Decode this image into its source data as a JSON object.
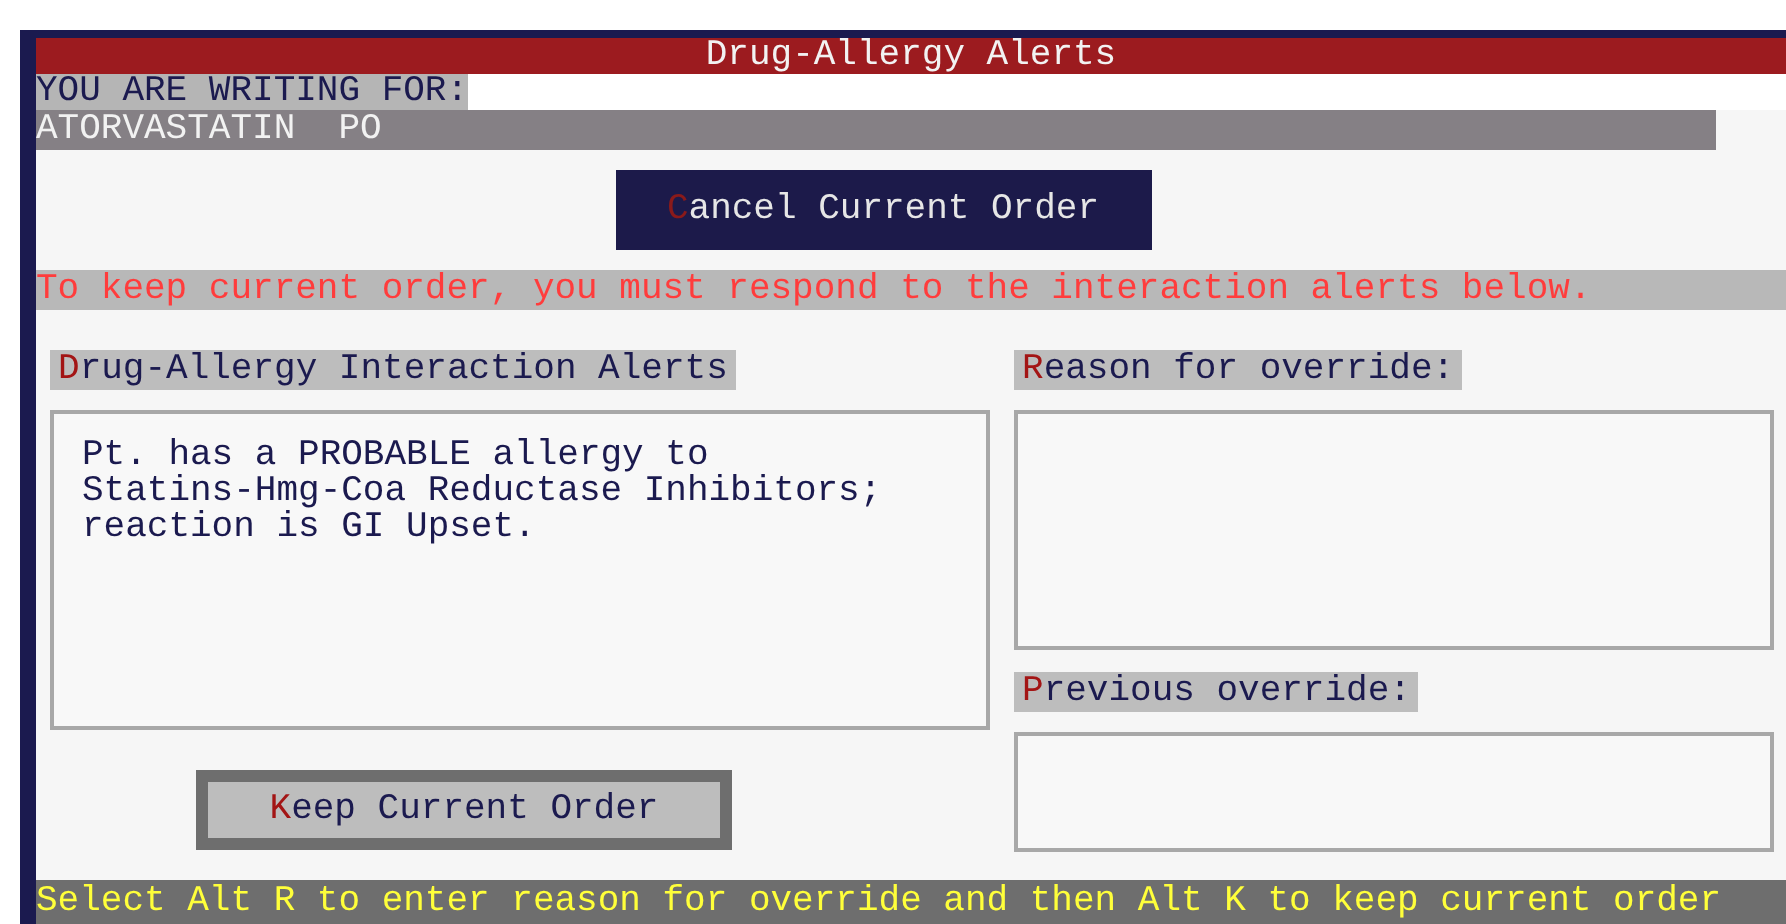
{
  "window": {
    "title": "Drug-Allergy Alerts"
  },
  "writing_for": {
    "label": "YOU ARE WRITING FOR:",
    "drug": "ATORVASTATIN  PO"
  },
  "cancel_button": {
    "hotkey": "C",
    "rest": "ancel Current Order"
  },
  "instruction": "To keep current order, you must respond to the interaction alerts below.",
  "alerts": {
    "heading": {
      "hotkey": "D",
      "rest": "rug-Allergy Interaction Alerts"
    },
    "lines": [
      "Pt. has a PROBABLE allergy to",
      "Statins-Hmg-Coa Reductase Inhibitors;",
      "reaction is GI Upset."
    ]
  },
  "reason": {
    "heading": {
      "hotkey": "R",
      "rest": "eason for override:"
    }
  },
  "previous": {
    "heading": {
      "hotkey": "P",
      "rest": "revious override:"
    }
  },
  "keep_button": {
    "hotkey": "K",
    "rest": "eep Current Order"
  },
  "status_bar": "Select Alt R to enter reason for override and then Alt K to keep current order"
}
